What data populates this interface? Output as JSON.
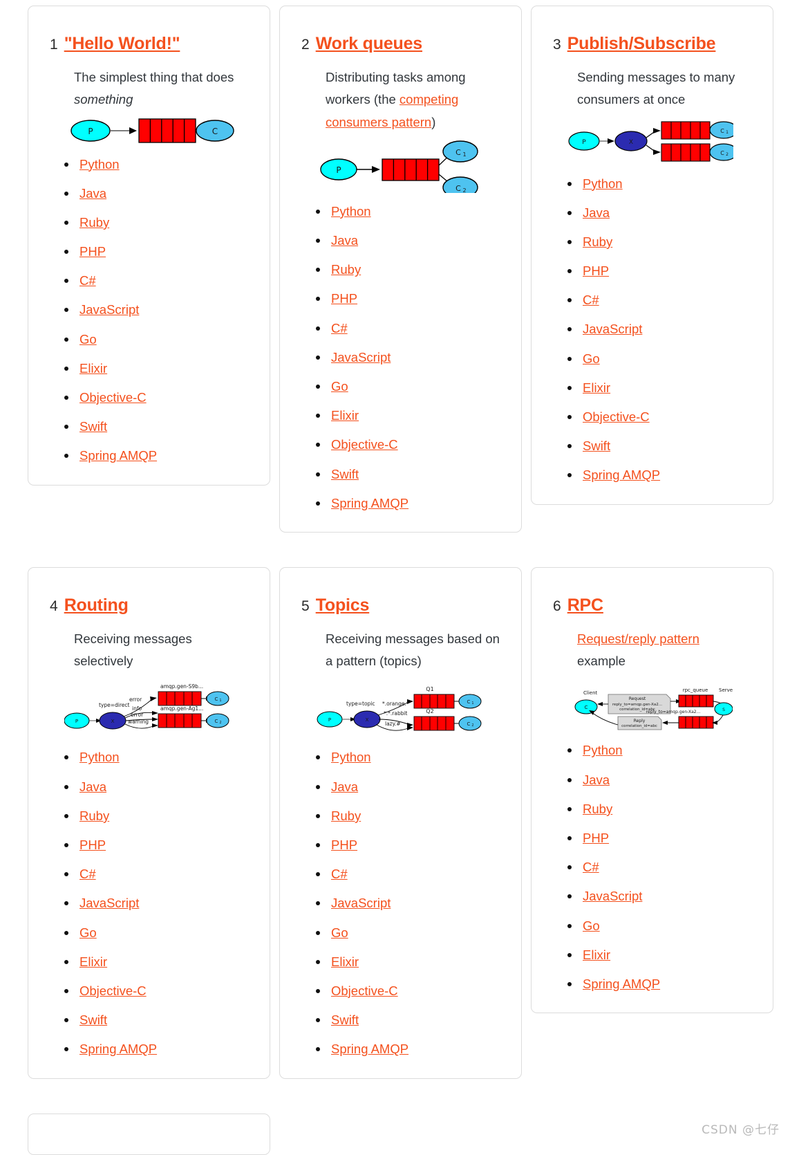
{
  "languages_full": [
    "Python",
    "Java",
    "Ruby",
    "PHP",
    "C#",
    "JavaScript",
    "Go",
    "Elixir",
    "Objective-C",
    "Swift",
    "Spring AMQP"
  ],
  "colors": {
    "link": "#f4511e",
    "producer": "#00ffff",
    "consumer": "#4ec3f0",
    "exchange": "#2b2bb0",
    "queue": "#ff0000",
    "card_border": "#dcdcdc",
    "text": "#32373c",
    "watermark": "#b9b9b9"
  },
  "cards": [
    {
      "number": "1",
      "title": "\"Hello World!\"",
      "desc_pre": "The simplest thing that does ",
      "desc_em": "something",
      "diagram": {
        "producer": "P",
        "consumers": [
          "C"
        ],
        "queues": 1
      },
      "languages": [
        "Python",
        "Java",
        "Ruby",
        "PHP",
        "C#",
        "JavaScript",
        "Go",
        "Elixir",
        "Objective-C",
        "Swift",
        "Spring AMQP"
      ]
    },
    {
      "number": "2",
      "title": "Work queues",
      "desc_pre": "Distributing tasks among workers (the ",
      "desc_link": "competing consumers pattern",
      "desc_post": ")",
      "diagram": {
        "producer": "P",
        "consumers": [
          "C",
          "C"
        ],
        "consumer_subs": [
          "1",
          "2"
        ],
        "queues": 1
      },
      "languages": [
        "Python",
        "Java",
        "Ruby",
        "PHP",
        "C#",
        "JavaScript",
        "Go",
        "Elixir",
        "Objective-C",
        "Swift",
        "Spring AMQP"
      ]
    },
    {
      "number": "3",
      "title": "Publish/Subscribe",
      "desc_pre": "Sending messages to many consumers at once",
      "diagram": {
        "producer": "P",
        "exchange": "X",
        "consumers": [
          "C",
          "C"
        ],
        "consumer_subs": [
          "1",
          "2"
        ],
        "queues": 2
      },
      "languages": [
        "Python",
        "Java",
        "Ruby",
        "PHP",
        "C#",
        "JavaScript",
        "Go",
        "Elixir",
        "Objective-C",
        "Swift",
        "Spring AMQP"
      ]
    },
    {
      "number": "4",
      "title": "Routing",
      "desc_pre": "Receiving messages selectively",
      "diagram": {
        "producer": "P",
        "exchange": "X",
        "exchange_label": "type=direct",
        "queue_labels": [
          "amqp.gen-S9b...",
          "amqp.gen-Ag1..."
        ],
        "binding_keys": [
          "error",
          "info",
          "error",
          "warning"
        ],
        "consumers": [
          "C",
          "C"
        ],
        "consumer_subs": [
          "1",
          "2"
        ]
      },
      "languages": [
        "Python",
        "Java",
        "Ruby",
        "PHP",
        "C#",
        "JavaScript",
        "Go",
        "Elixir",
        "Objective-C",
        "Swift",
        "Spring AMQP"
      ]
    },
    {
      "number": "5",
      "title": "Topics",
      "desc_pre": "Receiving messages based on a pattern (topics)",
      "diagram": {
        "producer": "P",
        "exchange": "X",
        "exchange_label": "type=topic",
        "queue_labels": [
          "Q1",
          "Q2"
        ],
        "binding_keys": [
          "*.orange.*",
          "*.*.rabbit",
          "lazy.#"
        ],
        "consumers": [
          "C",
          "C"
        ],
        "consumer_subs": [
          "1",
          "2"
        ]
      },
      "languages": [
        "Python",
        "Java",
        "Ruby",
        "PHP",
        "C#",
        "JavaScript",
        "Go",
        "Elixir",
        "Objective-C",
        "Swift",
        "Spring AMQP"
      ]
    },
    {
      "number": "6",
      "title": "RPC",
      "desc_link": "Request/reply pattern",
      "desc_post": "example",
      "diagram": {
        "client_label": "Client",
        "server_label": "Server",
        "client": "C",
        "server": "S",
        "queue_label": "rpc_queue",
        "reply_label": "reply_to=amqp.gen-Xa2...",
        "request_box": [
          "Request",
          "reply_to=amqp.gen-Xa2...",
          "correlation_id=abc"
        ],
        "reply_box": [
          "Reply",
          "correlation_id=abc"
        ]
      },
      "languages": [
        "Python",
        "Java",
        "Ruby",
        "PHP",
        "C#",
        "JavaScript",
        "Go",
        "Elixir",
        "Spring AMQP"
      ]
    }
  ],
  "watermark": "CSDN @七仔"
}
